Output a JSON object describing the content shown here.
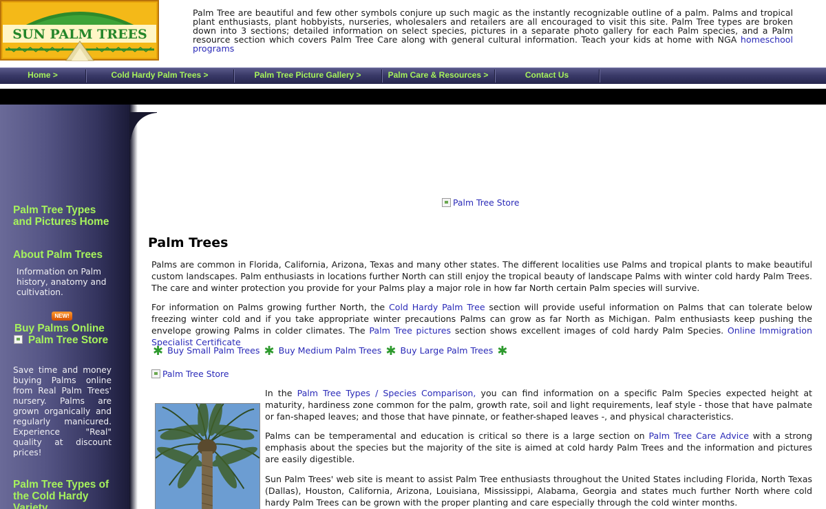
{
  "logo": {
    "text": "SUN PALM TREES"
  },
  "intro": {
    "text": "Palm Tree are beautiful and few other symbols conjure up such magic as the instantly recognizable outline of a palm. Palms and tropical plant enthusiasts, plant hobbyists, nurseries, wholesalers and retailers are all encouraged to visit this site. Palm Tree types are broken down into 3 sections; detailed information on select species, pictures in a separate photo gallery for each Palm species, and a Palm resource section which covers Palm Tree Care along with general cultural information. Teach your kids at home with NGA ",
    "link": "homeschool programs"
  },
  "nav": {
    "items": [
      "Home >",
      "Cold Hardy Palm Trees >",
      "Palm Tree Picture Gallery >",
      "Palm Care & Resources >",
      "Contact Us"
    ]
  },
  "sidebar": {
    "home_link": "Palm Tree Types and Pictures Home",
    "about_title": "About Palm Trees",
    "about_text": "Information on Palm history, anatomy and cultivation.",
    "new_badge": "NEW!",
    "buy_title": "Buy Palms Online",
    "store_alt": "Palm Tree Store",
    "buy_text": "Save time and money buying Palms online from Real Palm Trees' nursery. Palms are grown organically and regularly manicured. Experience \"Real\" quality at discount prices!",
    "cold_hardy_title": "Palm Tree Types of the Cold Hardy Variety"
  },
  "main": {
    "store_top_alt": "Palm Tree Store",
    "title": "Palm Trees",
    "para1": "Palms are common in Florida, California, Arizona, Texas and many other states. The different localities use Palms and tropical plants to make beautiful custom landscapes. Palm enthusiasts in locations further North can still enjoy the tropical beauty of landscape Palms with winter cold hardy Palm Trees. The care and winter protection you provide for your Palms play a major role in how far North certain Palm species will survive.",
    "para2": {
      "a": "For information on Palms growing further North, the ",
      "link1": "Cold Hardy Palm Tree",
      "b": " section will provide useful information on Palms that can tolerate below freezing winter cold and if you take appropriate winter precautions Palms can grow as far North as Michigan. Palm enthusiasts keep pushing the envelope growing Palms in colder climates. The ",
      "link2": "Palm Tree pictures",
      "c": " section shows excellent images of cold hardy Palm Species. ",
      "link3": "Online Immigration Specialist Certificate"
    },
    "buy_links": [
      "Buy Small Palm Trees",
      "Buy Medium Palm Trees",
      "Buy Large Palm Trees"
    ],
    "store_mid_alt": "Palm Tree Store",
    "para3": {
      "a": "In the ",
      "link": "Palm Tree Types / Species Comparison,",
      "b": " you can find information on a specific Palm Species expected height at maturity, hardiness zone common for the palm, growth rate, soil and light requirements, leaf style - those that have palmate or fan-shaped leaves; and those that have pinnate, or feather-shaped leaves -, and physical characteristics."
    },
    "para4": {
      "a": "Palms can be temperamental and education is critical so there is a large section on ",
      "link": "Palm Tree Care Advice",
      "b": " with a strong emphasis about the species but the majority of the site is aimed at cold hardy Palm Trees and the information and pictures are easily digestible."
    },
    "para5": "Sun Palm Trees' web site is meant to assist Palm Tree enthusiasts throughout the United States including Florida, North Texas (Dallas), Houston, California, Arizona, Louisiana, Mississippi, Alabama, Georgia and states much further North where cold hardy Palm Trees can be grown with the proper planting and care especially through the cold winter months."
  },
  "colors": {
    "nav_text": "#a6f25c",
    "link": "#2a2ab8",
    "sidebar": "#555585",
    "logo_bg": "#f2b311"
  }
}
